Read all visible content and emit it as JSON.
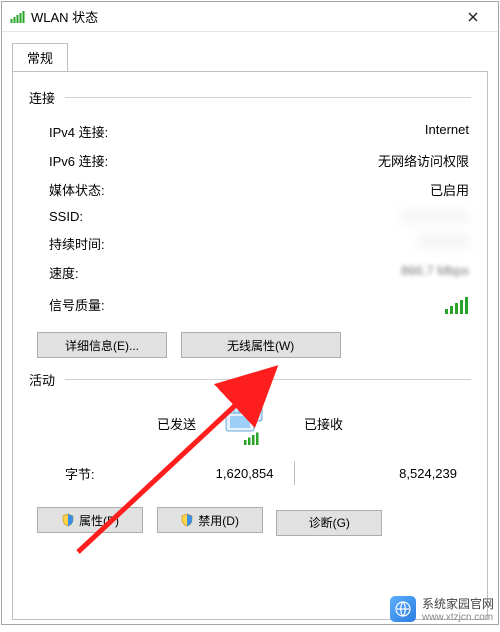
{
  "window": {
    "title": "WLAN 状态",
    "close_tooltip": "关闭"
  },
  "tab": {
    "label": "常规"
  },
  "connection": {
    "header": "连接",
    "ipv4_label": "IPv4 连接:",
    "ipv4_value": "Internet",
    "ipv6_label": "IPv6 连接:",
    "ipv6_value": "无网络访问权限",
    "media_label": "媒体状态:",
    "media_value": "已启用",
    "ssid_label": "SSID:",
    "ssid_value": "",
    "duration_label": "持续时间:",
    "duration_value": "",
    "speed_label": "速度:",
    "speed_value": "866.7 Mbps",
    "signal_label": "信号质量:"
  },
  "buttons": {
    "details": "详细信息(E)...",
    "wireless_props": "无线属性(W)",
    "properties": "属性(P)",
    "disable": "禁用(D)",
    "diagnose": "诊断(G)"
  },
  "activity": {
    "header": "活动",
    "sent_label": "已发送",
    "recv_label": "已接收",
    "bytes_label": "字节:",
    "bytes_sent": "1,620,854",
    "bytes_recv": "8,524,239"
  },
  "watermark": {
    "brand": "系统家园官网",
    "url": "www.xtzjcn.com"
  }
}
